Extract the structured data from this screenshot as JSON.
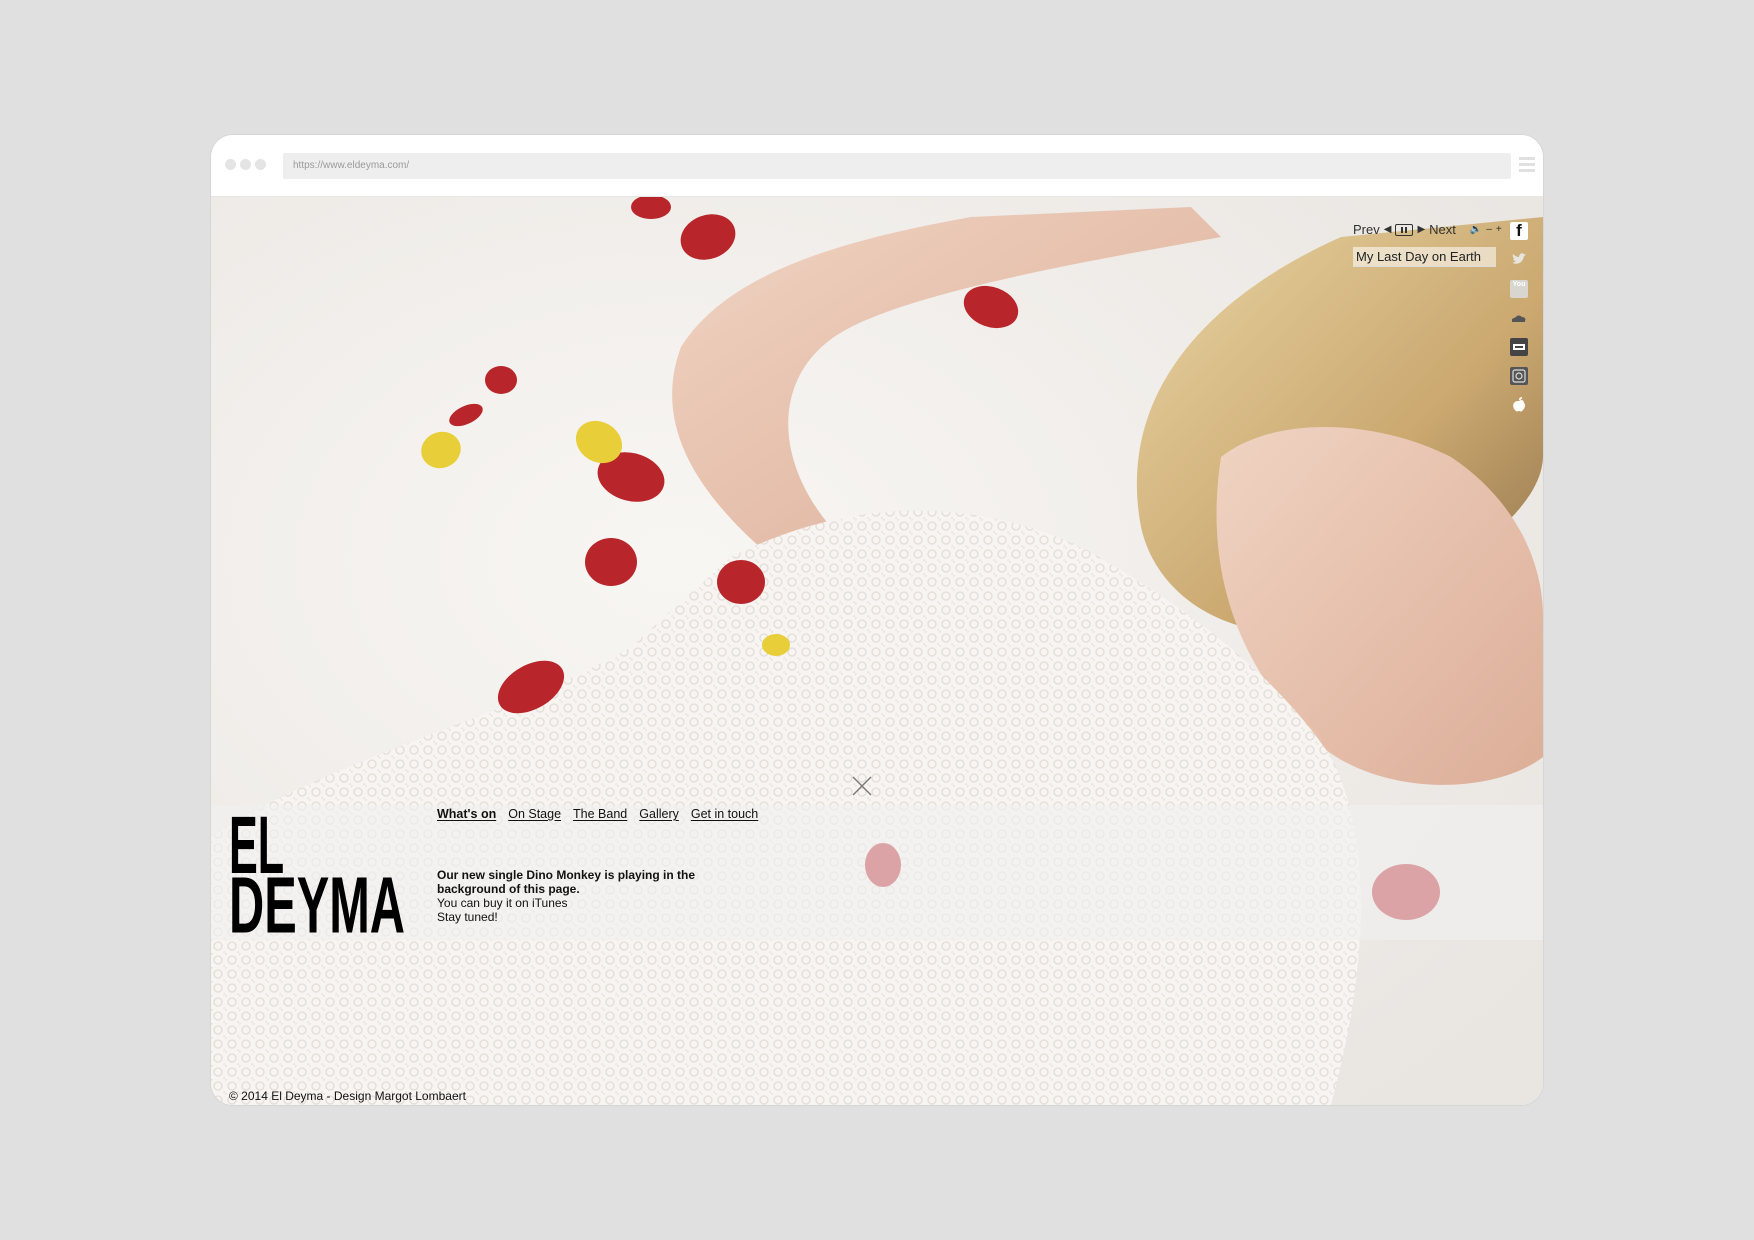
{
  "browser": {
    "url": "https://www.eldeyma.com/"
  },
  "player": {
    "prev_label": "Prev",
    "next_label": "Next",
    "volume_down": "–",
    "volume_up": "+",
    "track_title": "My Last Day on Earth"
  },
  "social": [
    {
      "name": "facebook",
      "glyph": "f"
    },
    {
      "name": "twitter",
      "glyph": ""
    },
    {
      "name": "youtube",
      "glyph": "You"
    },
    {
      "name": "soundcloud",
      "glyph": ""
    },
    {
      "name": "deezer",
      "glyph": ""
    },
    {
      "name": "instagram",
      "glyph": ""
    },
    {
      "name": "apple",
      "glyph": ""
    }
  ],
  "logo": {
    "line1": "EL",
    "line2": "DEYMA"
  },
  "nav": {
    "items": [
      {
        "label": "What's on",
        "active": true
      },
      {
        "label": "On Stage",
        "active": false
      },
      {
        "label": "The Band",
        "active": false
      },
      {
        "label": "Gallery",
        "active": false
      },
      {
        "label": "Get in touch",
        "active": false
      }
    ]
  },
  "news": {
    "headline": "Our new single Dino Monkey is playing in the background of this page.",
    "line2": "You can buy it on iTunes",
    "line3": "Stay tuned!"
  },
  "footer": {
    "copyright": "© 2014 El Deyma - Design Margot Lombaert"
  },
  "colors": {
    "page_bg": "#e0e0e0",
    "petal_red": "#b8262b",
    "petal_yellow": "#e8cf3a",
    "text": "#111111"
  }
}
